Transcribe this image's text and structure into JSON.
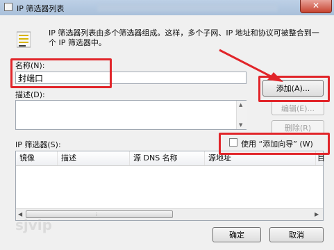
{
  "window": {
    "title": "IP 筛选器列表",
    "close_label": "✕"
  },
  "dialog": {
    "description": "IP 筛选器列表由多个筛选器组成。这样，多个子网、IP 地址和协议可被整合到一个 IP 筛选器中。",
    "name_label": "名称(N):",
    "name_value": "封端口",
    "desc_label": "描述(D):",
    "buttons": {
      "add": "添加(A)...",
      "edit": "编辑(E)...",
      "delete": "删除(R)"
    },
    "filters_label": "IP 筛选器(S):",
    "use_wizard_label": "使用 “添加向导” (W)",
    "table": {
      "columns": [
        "镜像",
        "描述",
        "源 DNS 名称",
        "源地址",
        "目"
      ]
    },
    "footer": {
      "ok": "确定",
      "cancel": "取消"
    }
  },
  "watermark": "sjvip",
  "colors": {
    "annotation": "#e1252a",
    "window_frame": "#bdd0e6"
  },
  "icons": {
    "title": "filter-list-icon",
    "dialog": "filter-list-icon",
    "close": "close-icon"
  }
}
